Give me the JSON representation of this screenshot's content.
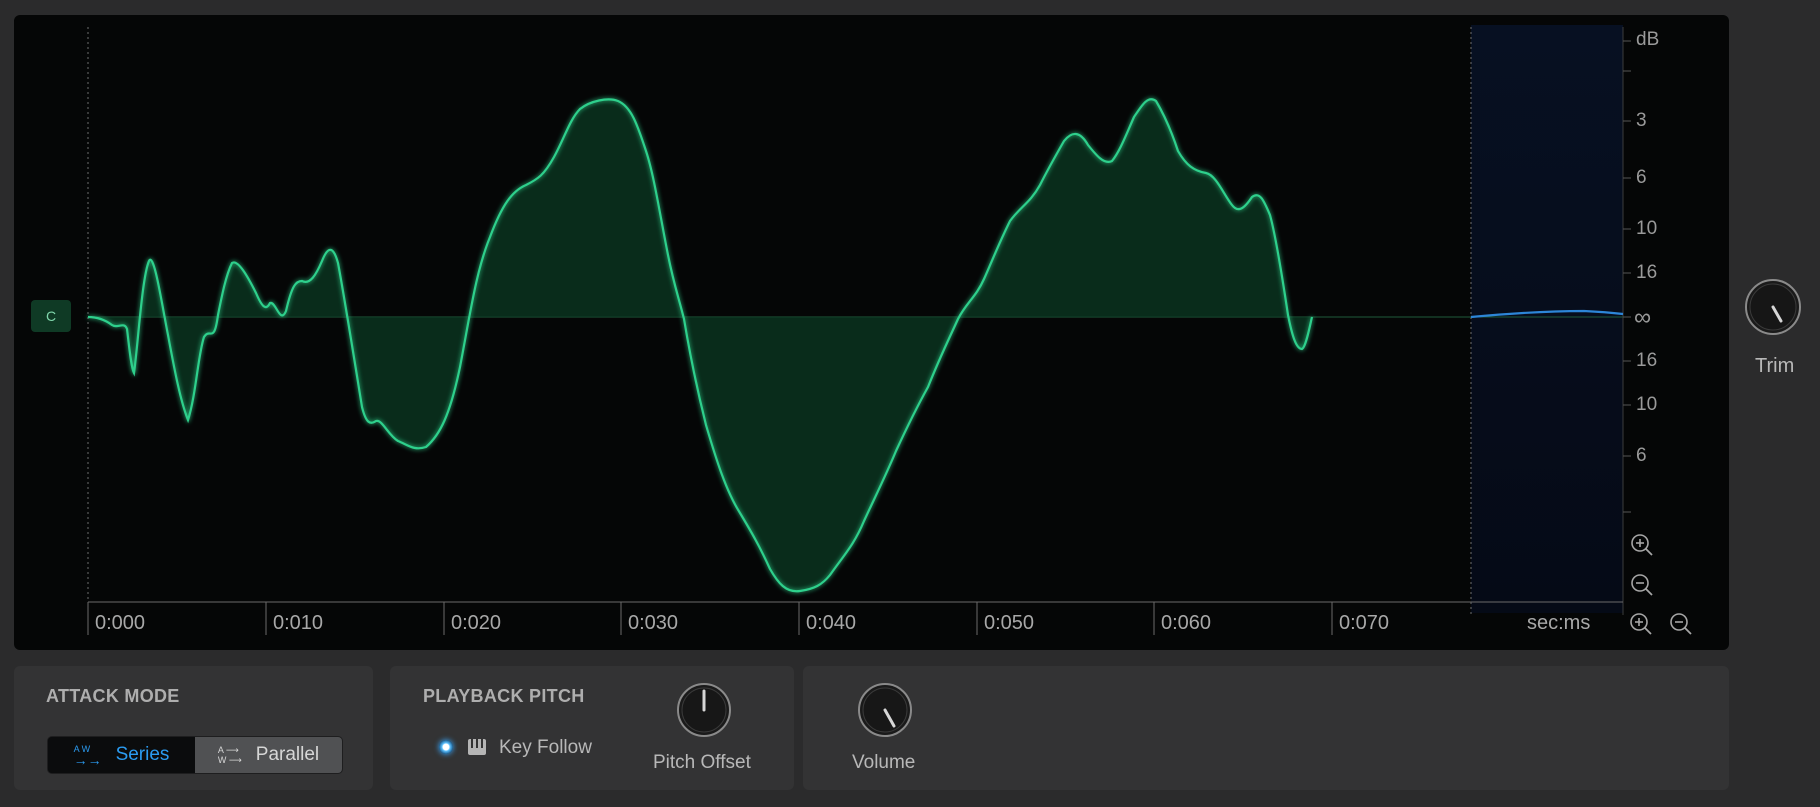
{
  "display": {
    "db_scale": {
      "unit": "dB",
      "labels": [
        "3",
        "6",
        "10",
        "16",
        "∞",
        "16",
        "10",
        "6"
      ]
    },
    "time_axis": {
      "labels": [
        "0:000",
        "0:010",
        "0:020",
        "0:030",
        "0:040",
        "0:050",
        "0:060",
        "0:070"
      ],
      "units": "sec:ms"
    },
    "channel_badge": "C",
    "colors": {
      "waveform": "#2fd08c",
      "fill": "#0b3a23",
      "tail": "#2d86d8",
      "background": "#050606"
    },
    "icons": [
      "zoom-in-icon",
      "zoom-out-icon"
    ]
  },
  "trim": {
    "label": "Trim"
  },
  "attack_mode": {
    "title": "ATTACK MODE",
    "options": [
      {
        "label": "Series",
        "icon_top": "A W",
        "active": true
      },
      {
        "label": "Parallel",
        "icon_top": "A",
        "icon_bottom": "W",
        "active": false
      }
    ]
  },
  "playback_pitch": {
    "title": "PLAYBACK PITCH",
    "key_follow": {
      "label": "Key Follow",
      "selected": true
    },
    "pitch_offset": {
      "label": "Pitch Offset"
    }
  },
  "volume": {
    "label": "Volume"
  }
}
